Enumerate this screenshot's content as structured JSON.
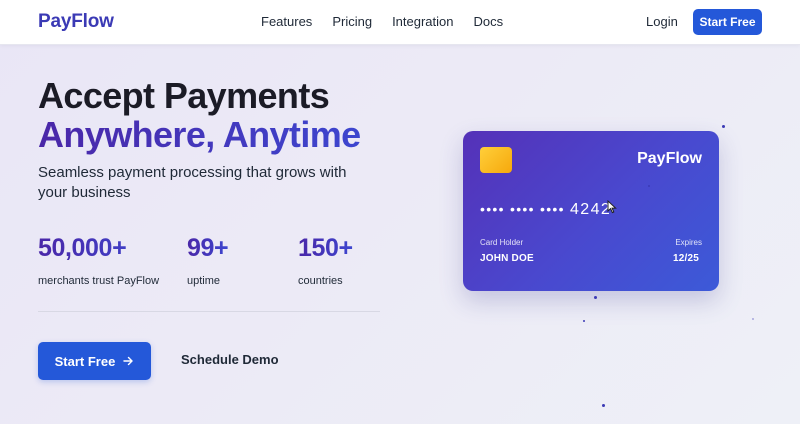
{
  "nav": {
    "logo": "PayFlow",
    "links": [
      "Features",
      "Pricing",
      "Integration",
      "Docs"
    ],
    "login": "Login",
    "cta": "Start Free"
  },
  "hero": {
    "headline_line1": "Accept Payments",
    "headline_line2": "Anywhere, Anytime",
    "subtitle": "Seamless payment processing that grows with your business"
  },
  "stats": [
    {
      "value": "50,000+",
      "label": "merchants trust PayFlow"
    },
    {
      "value": "99+",
      "label": "uptime"
    },
    {
      "value": "150+",
      "label": "countries"
    }
  ],
  "actions": {
    "primary": "Start Free",
    "primary_icon": "arrow-right-icon",
    "secondary": "Schedule Demo"
  },
  "card": {
    "brand": "PayFlow",
    "number_masked": "•••• •••• ••••",
    "number_last": "4242",
    "holder_label": "Card Holder",
    "holder_name": "JOHN DOE",
    "expires_label": "Expires",
    "expires_value": "12/25"
  },
  "colors": {
    "brand": "#3b3ab5",
    "accent": "#2458d9",
    "gradient_start": "#4a27a8",
    "gradient_end": "#3d46cf",
    "chip": "#f6a80c"
  }
}
